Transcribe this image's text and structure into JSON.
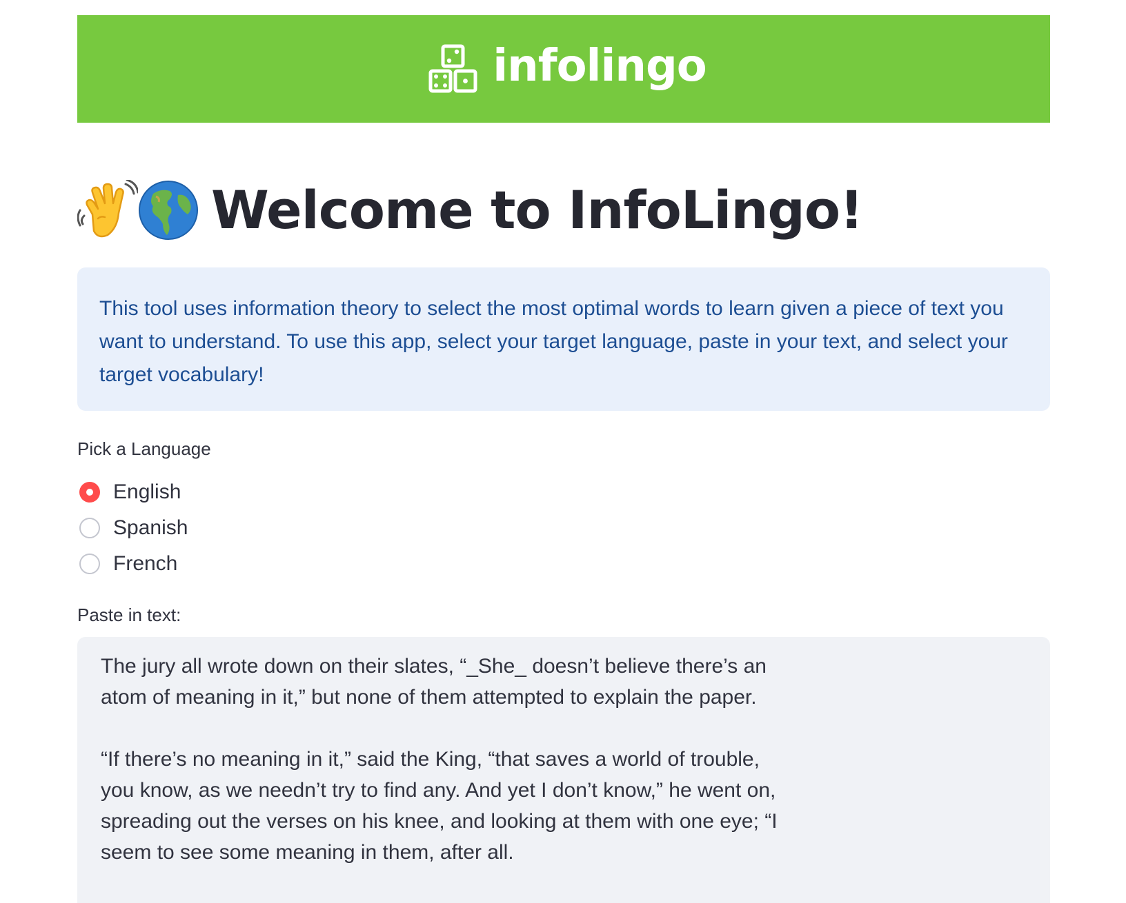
{
  "header": {
    "logo_text": "infolingo",
    "logo_icon": "dice-blocks-icon",
    "background_color": "#77c93f"
  },
  "main": {
    "title_emoji": [
      "waving-hand-icon",
      "globe-americas-icon"
    ],
    "title": "Welcome to InfoLingo!",
    "info_text": "This tool uses information theory to select the most optimal words to learn given a piece of text you want to understand. To use this app, select your target language, paste in your text, and select your target vocabulary!",
    "language": {
      "label": "Pick a Language",
      "options": [
        "English",
        "Spanish",
        "French"
      ],
      "selected": "English"
    },
    "text_input": {
      "label": "Paste in text:",
      "value": "The jury all wrote down on their slates, “_She_ doesn’t believe there’s an atom of meaning in it,” but none of them attempted to explain the paper.\n\n“If there’s no meaning in it,” said the King, “that saves a world of trouble, you know, as we needn’t try to find any. And yet I don’t know,” he went on, spreading out the verses on his knee, and looking at them with one eye; “I seem to see some meaning in them, after all."
    }
  },
  "colors": {
    "accent": "#ff4b4b",
    "info_bg": "#e9f0fb",
    "info_text": "#1d4e93",
    "input_bg": "#f0f2f6"
  }
}
